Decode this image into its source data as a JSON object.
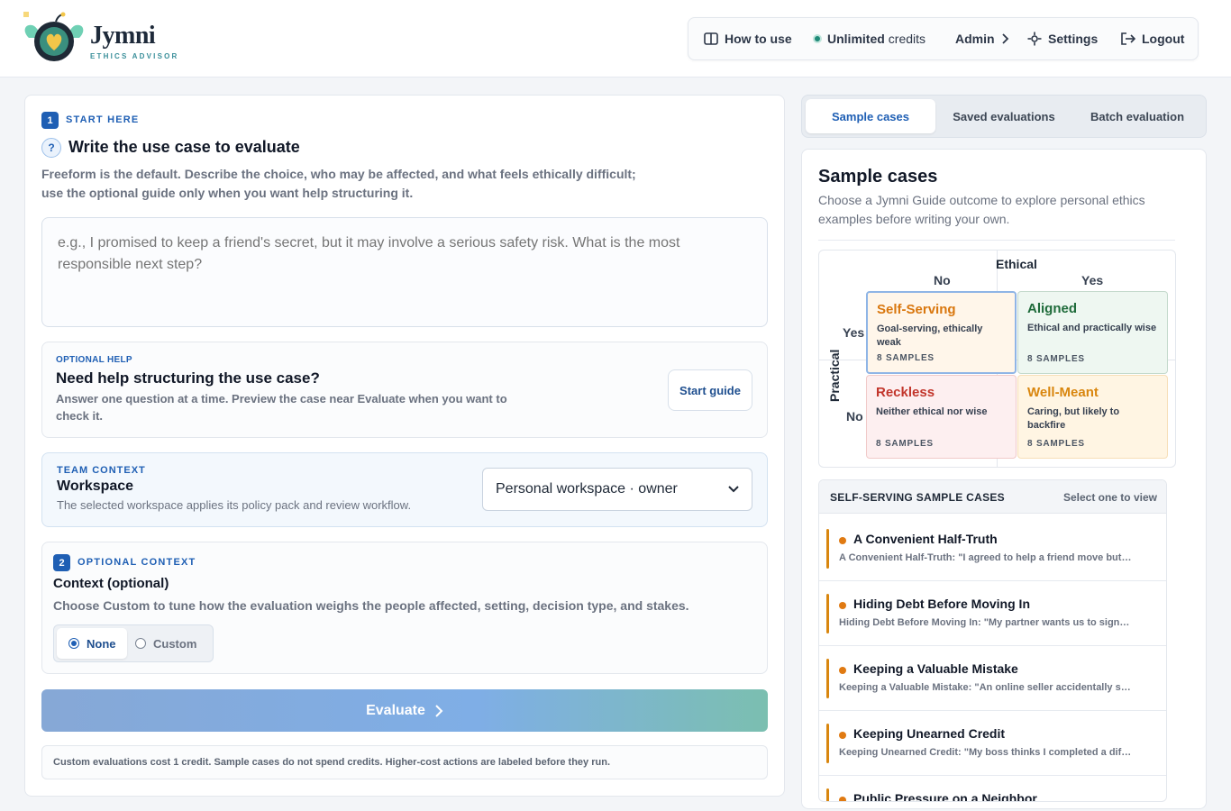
{
  "brand": {
    "name": "Jymni",
    "tagline": "ETHICS ADVISOR"
  },
  "nav": {
    "how_to_use": "How to use",
    "credits_strong": "Unlimited",
    "credits_rest": "credits",
    "admin": "Admin",
    "settings": "Settings",
    "logout": "Logout"
  },
  "step1": {
    "number": "1",
    "eyebrow": "START HERE",
    "help_icon": "?",
    "title": "Write the use case to evaluate",
    "description": "Freeform is the default. Describe the choice, who may be affected, and what feels ethically difficult; use the optional guide only when you want help structuring it.",
    "placeholder": "e.g., I promised to keep a friend's secret, but it may involve a serious safety risk. What is the most responsible next step?"
  },
  "guide": {
    "eyebrow": "OPTIONAL HELP",
    "title": "Need help structuring the use case?",
    "description": "Answer one question at a time. Preview the case near Evaluate when you want to check it.",
    "button": "Start guide"
  },
  "team": {
    "eyebrow": "TEAM CONTEXT",
    "title": "Workspace",
    "description": "The selected workspace applies its policy pack and review workflow.",
    "selected": "Personal workspace · owner"
  },
  "step2": {
    "number": "2",
    "eyebrow": "OPTIONAL CONTEXT",
    "title": "Context (optional)",
    "description": "Choose Custom to tune how the evaluation weighs the people affected, setting, decision type, and stakes.",
    "options": [
      "None",
      "Custom"
    ],
    "selected": "None"
  },
  "evaluate": {
    "label": "Evaluate",
    "note": "Custom evaluations cost 1 credit. Sample cases do not spend credits. Higher-cost actions are labeled before they run."
  },
  "tabs": [
    "Sample cases",
    "Saved evaluations",
    "Batch evaluation"
  ],
  "active_tab": "Sample cases",
  "samples": {
    "title": "Sample cases",
    "description": "Choose a Jymni Guide outcome to explore personal ethics examples before writing your own.",
    "matrix": {
      "x_axis": "Ethical",
      "y_axis": "Practical",
      "x_no": "No",
      "x_yes": "Yes",
      "y_yes": "Yes",
      "y_no": "No",
      "cells": [
        {
          "name": "Self-Serving",
          "desc": "Goal-serving, ethically weak",
          "count": "8 SAMPLES",
          "color": "#d9770e",
          "bg": "#fff6ea",
          "selected": true
        },
        {
          "name": "Aligned",
          "desc": "Ethical and practically wise",
          "count": "8 SAMPLES",
          "color": "#1e6b3a",
          "bg": "#eef7f1",
          "selected": false
        },
        {
          "name": "Reckless",
          "desc": "Neither ethical nor wise",
          "count": "8 SAMPLES",
          "color": "#c2352b",
          "bg": "#fdeff0",
          "selected": false
        },
        {
          "name": "Well-Meant",
          "desc": "Caring, but likely to backfire",
          "count": "8 SAMPLES",
          "color": "#d9860e",
          "bg": "#fff5e3",
          "selected": false
        }
      ]
    },
    "list_title": "SELF-SERVING SAMPLE CASES",
    "list_hint": "Select one to view",
    "cases": [
      {
        "title": "A Convenient Half-Truth",
        "snippet": "A Convenient Half-Truth: \"I agreed to help a friend move but…"
      },
      {
        "title": "Hiding Debt Before Moving In",
        "snippet": "Hiding Debt Before Moving In: \"My partner wants us to sign…"
      },
      {
        "title": "Keeping a Valuable Mistake",
        "snippet": "Keeping a Valuable Mistake: \"An online seller accidentally s…"
      },
      {
        "title": "Keeping Unearned Credit",
        "snippet": "Keeping Unearned Credit: \"My boss thinks I completed a dif…"
      },
      {
        "title": "Public Pressure on a Neighbor",
        "snippet": ""
      }
    ]
  }
}
